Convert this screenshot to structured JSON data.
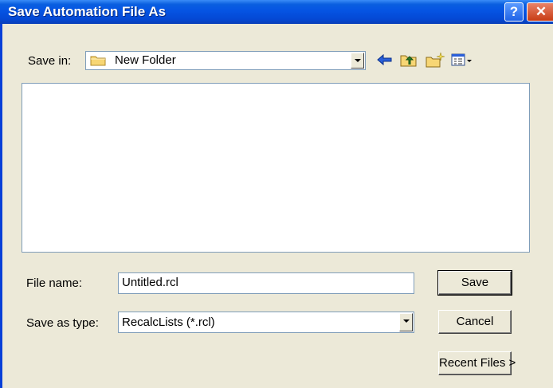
{
  "window": {
    "title": "Save Automation File As",
    "help_label": "?",
    "close_label": "✕"
  },
  "save_in": {
    "label": "Save in:",
    "value": "New Folder"
  },
  "toolbar": {
    "icons": [
      "back-icon",
      "up-one-level-icon",
      "new-folder-icon",
      "view-menu-icon"
    ]
  },
  "file_name": {
    "label": "File name:",
    "value": "Untitled.rcl"
  },
  "save_as_type": {
    "label": "Save as type:",
    "value": "RecalcLists (*.rcl)"
  },
  "buttons": {
    "save": "Save",
    "cancel": "Cancel",
    "recent_files": "Recent Files >"
  }
}
